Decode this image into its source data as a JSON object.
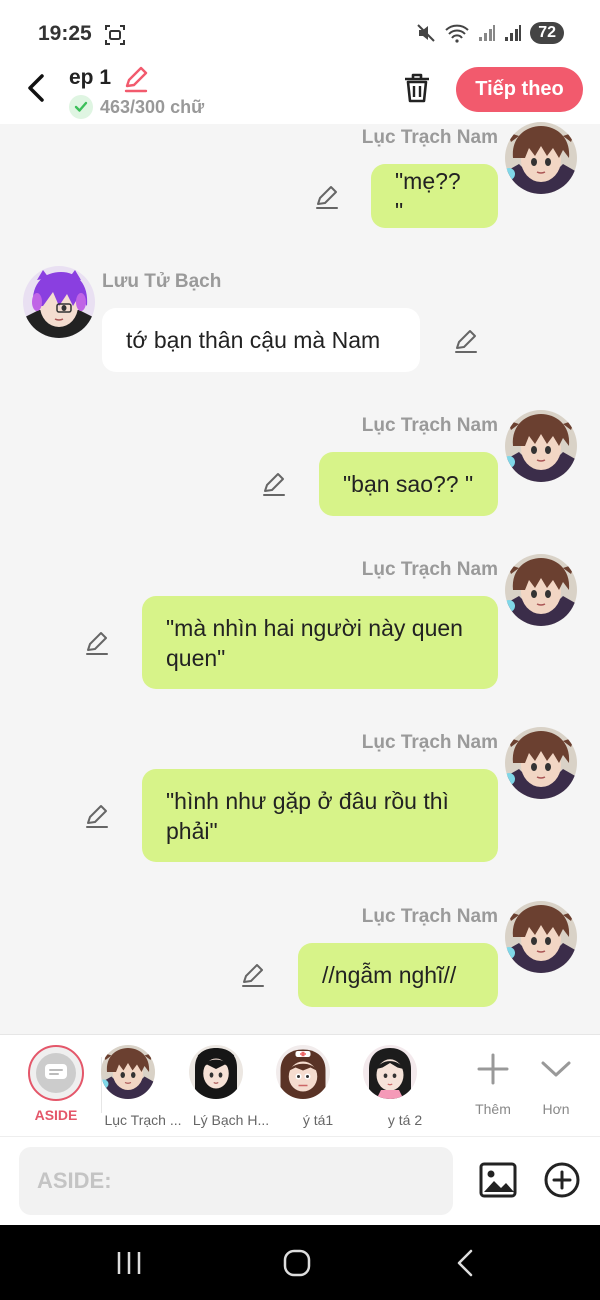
{
  "status_bar": {
    "time": "19:25",
    "battery": "72",
    "icons": [
      "screen-record-icon",
      "mute-icon",
      "wifi-icon",
      "signal-icon",
      "signal-icon"
    ]
  },
  "header": {
    "title": "ep 1",
    "word_count": "463/300 chữ",
    "next_label": "Tiếp theo",
    "accent_color": "#f25a6d"
  },
  "messages": [
    {
      "side": "right",
      "name": "Lục Trạch Nam",
      "text": "\"mẹ?? \""
    },
    {
      "side": "left",
      "name": "Lưu Tử Bạch",
      "text": "tớ bạn thân cậu mà Nam"
    },
    {
      "side": "right",
      "name": "Lục Trạch Nam",
      "text": "\"bạn sao?? \""
    },
    {
      "side": "right",
      "name": "Lục Trạch Nam",
      "text": "\"mà nhìn hai người này quen quen\""
    },
    {
      "side": "right",
      "name": "Lục Trạch Nam",
      "text": "\"hình như gặp ở đâu rồu thì phải\""
    },
    {
      "side": "right",
      "name": "Lục Trạch Nam",
      "text": "//ngẫm nghĩ//"
    }
  ],
  "characters": {
    "aside_label": "ASIDE",
    "items": [
      {
        "label": "Lục Trạch ..."
      },
      {
        "label": "Lý Bạch H..."
      },
      {
        "label": "ý tá1"
      },
      {
        "label": "y tá 2"
      }
    ],
    "add_label": "Thêm",
    "more_label": "Hơn"
  },
  "input": {
    "placeholder": "ASIDE:"
  },
  "colors": {
    "bubble_green": "#d7f389",
    "bubble_white": "#ffffff",
    "background": "#f5f5f5"
  }
}
